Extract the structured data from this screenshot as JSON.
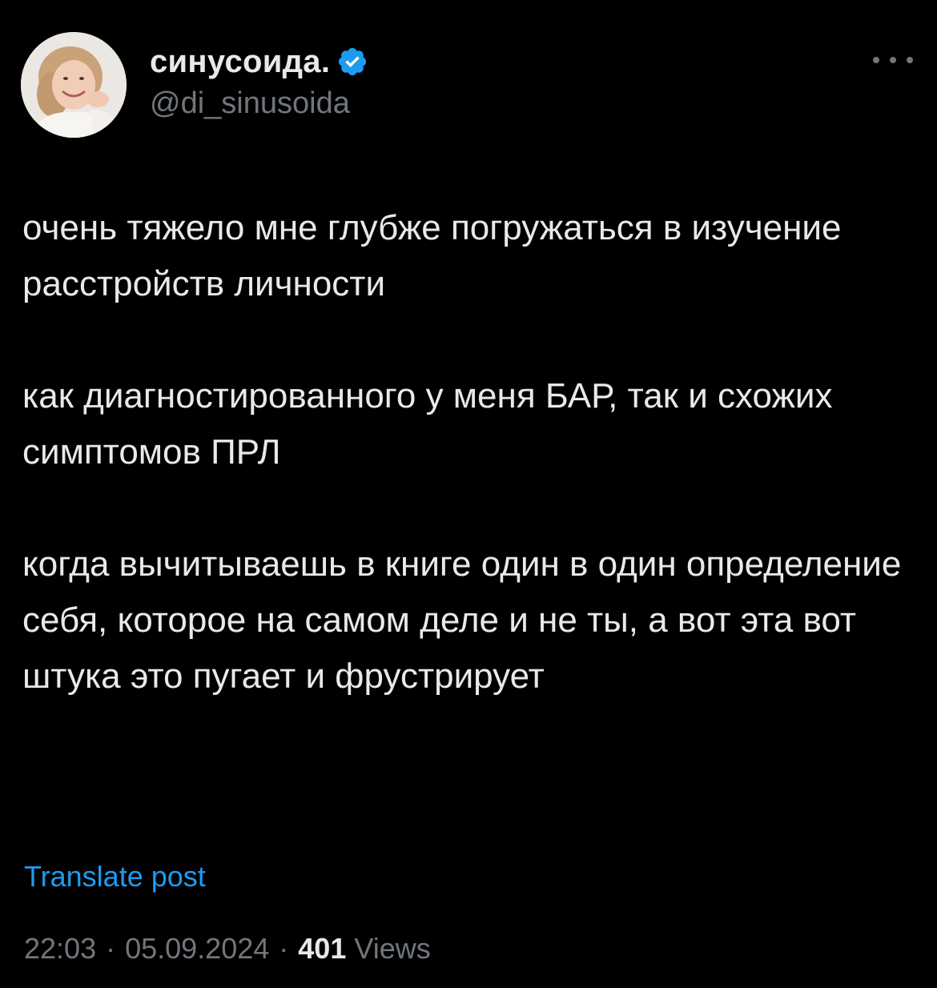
{
  "author": {
    "display_name": "синусоида.",
    "handle": "@di_sinusoida",
    "verified": true,
    "verified_icon": "verified-badge-icon",
    "avatar_icon": "profile-photo"
  },
  "menu_icon": "more-options-icon",
  "tweet": {
    "paragraphs": [
      "очень тяжело мне глубже погружаться в изучение расстройств личности",
      "как диагностированного у меня БАР, так и схожих симптомов ПРЛ",
      "когда вычитываешь в книге один в один определение себя, которое на самом деле и не ты, а вот эта вот штука это пугает и фрустрирует"
    ]
  },
  "translate_label": "Translate post",
  "meta": {
    "time": "22:03",
    "separator": "·",
    "date": "05.09.2024",
    "views_count": "401",
    "views_label": "Views"
  },
  "colors": {
    "background": "#000000",
    "text": "#e7e9ea",
    "muted": "#71767b",
    "accent": "#1d9bf0"
  }
}
